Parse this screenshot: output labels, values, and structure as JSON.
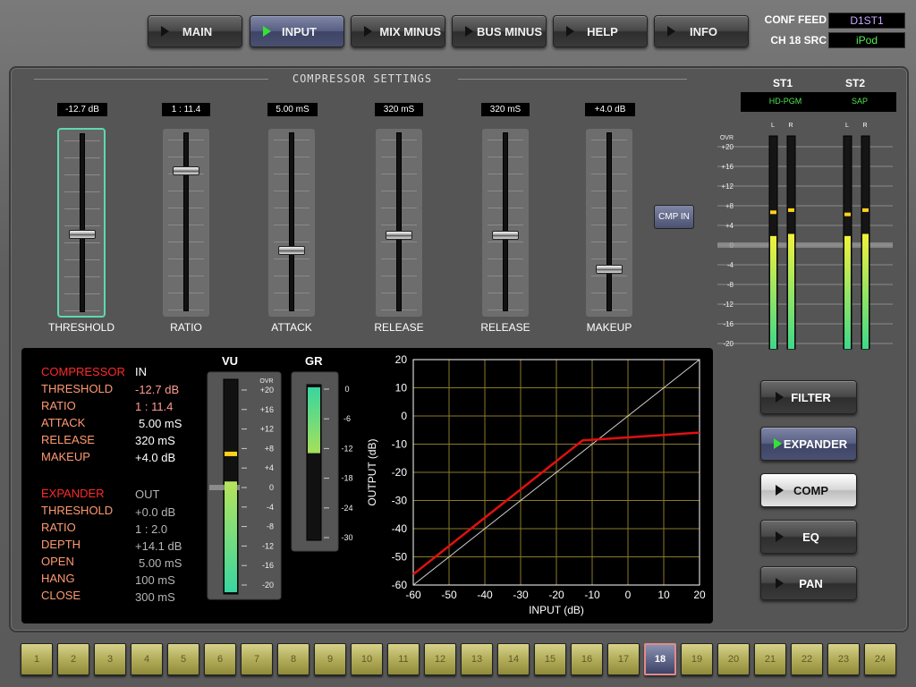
{
  "nav": [
    {
      "label": "MAIN",
      "active": false
    },
    {
      "label": "INPUT",
      "active": true
    },
    {
      "label": "MIX MINUS",
      "active": false
    },
    {
      "label": "BUS MINUS",
      "active": false
    },
    {
      "label": "HELP",
      "active": false
    },
    {
      "label": "INFO",
      "active": false
    }
  ],
  "header": {
    "conf_feed_label": "CONF FEED",
    "conf_feed_value": "D1ST1",
    "ch_src_label": "CH 18 SRC",
    "ch_src_value": "iPod"
  },
  "compressor_panel": {
    "title": "COMPRESSOR SETTINGS",
    "comp_in_label": "CMP IN",
    "faders": [
      {
        "name": "THRESHOLD",
        "value": "-12.7 dB",
        "level": 0.57,
        "selected": true
      },
      {
        "name": "RATIO",
        "value": "1 : 11.4",
        "level": 0.2,
        "selected": false
      },
      {
        "name": "ATTACK",
        "value": "5.00 mS",
        "level": 0.67,
        "selected": false
      },
      {
        "name": "RELEASE",
        "value": "320 mS",
        "level": 0.58,
        "selected": false
      },
      {
        "name": "RELEASE",
        "value": "320 mS",
        "level": 0.58,
        "selected": false
      },
      {
        "name": "MAKEUP",
        "value": "+4.0 dB",
        "level": 0.78,
        "selected": false
      }
    ]
  },
  "output_meters": {
    "st1_label": "ST1",
    "st2_label": "ST2",
    "st1_source": "HD-PGM",
    "st2_source": "SAP",
    "channel_labels": [
      "L",
      "R",
      "L",
      "R"
    ],
    "scale_top": "OVR",
    "scale": [
      "+20",
      "+16",
      "+12",
      "+8",
      "+4",
      "0",
      "-4",
      "-8",
      "-12",
      "-16",
      "-20"
    ],
    "levels": [
      0.53,
      0.54,
      0.53,
      0.54
    ],
    "peaks": [
      0.65,
      0.66,
      0.64,
      0.66
    ]
  },
  "status": {
    "compressor": {
      "title": "COMPRESSOR",
      "state": "IN",
      "rows": [
        {
          "label": "THRESHOLD",
          "value": "-12.7 dB"
        },
        {
          "label": "RATIO",
          "value": "1 : 11.4"
        },
        {
          "label": "ATTACK",
          "value": "5.00 mS"
        },
        {
          "label": "RELEASE",
          "value": "320 mS"
        },
        {
          "label": "MAKEUP",
          "value": "+4.0 dB"
        }
      ]
    },
    "expander": {
      "title": "EXPANDER",
      "state": "OUT",
      "rows": [
        {
          "label": "THRESHOLD",
          "value": "+0.0 dB"
        },
        {
          "label": "RATIO",
          "value": "1 : 2.0"
        },
        {
          "label": "DEPTH",
          "value": "+14.1 dB"
        },
        {
          "label": "OPEN",
          "value": "5.00 mS"
        },
        {
          "label": "HANG",
          "value": "100 mS"
        },
        {
          "label": "CLOSE",
          "value": "300 mS"
        }
      ]
    }
  },
  "vu_meter": {
    "label": "VU",
    "scale_top": "OVR",
    "scale": [
      "+20",
      "+16",
      "+12",
      "+8",
      "+4",
      "0",
      "-4",
      "-8",
      "-12",
      "-16",
      "-20"
    ],
    "level": 0.52,
    "peak": 0.66
  },
  "gr_meter": {
    "label": "GR",
    "scale": [
      "0",
      "-6",
      "-12",
      "-18",
      "-24",
      "-30"
    ],
    "level": 0.4
  },
  "chart_data": {
    "type": "line",
    "title": "",
    "xlabel": "INPUT (dB)",
    "ylabel": "OUTPUT (dB)",
    "xlim": [
      -60,
      20
    ],
    "ylim": [
      -60,
      20
    ],
    "xticks": [
      -60,
      -50,
      -40,
      -30,
      -20,
      -10,
      0,
      10,
      20
    ],
    "yticks": [
      20,
      10,
      0,
      -10,
      -20,
      -30,
      -40,
      -50,
      -60
    ],
    "grid": true,
    "series": [
      {
        "color": "#e01010",
        "x": [
          -60,
          -12.7,
          20
        ],
        "y": [
          -56.2,
          -8.7,
          -5.9
        ]
      },
      {
        "color": "#d0d0d0",
        "x": [
          -60,
          20
        ],
        "y": [
          -60,
          20
        ]
      }
    ]
  },
  "side_buttons": [
    {
      "label": "FILTER",
      "style": "normal"
    },
    {
      "label": "EXPANDER",
      "style": "active"
    },
    {
      "label": "COMP",
      "style": "white"
    },
    {
      "label": "EQ",
      "style": "normal"
    },
    {
      "label": "PAN",
      "style": "normal"
    }
  ],
  "channels": {
    "labels": [
      "1",
      "2",
      "3",
      "4",
      "5",
      "6",
      "7",
      "8",
      "9",
      "10",
      "11",
      "12",
      "13",
      "14",
      "15",
      "16",
      "17",
      "18",
      "19",
      "20",
      "21",
      "22",
      "23",
      "24"
    ],
    "selected": "18"
  }
}
